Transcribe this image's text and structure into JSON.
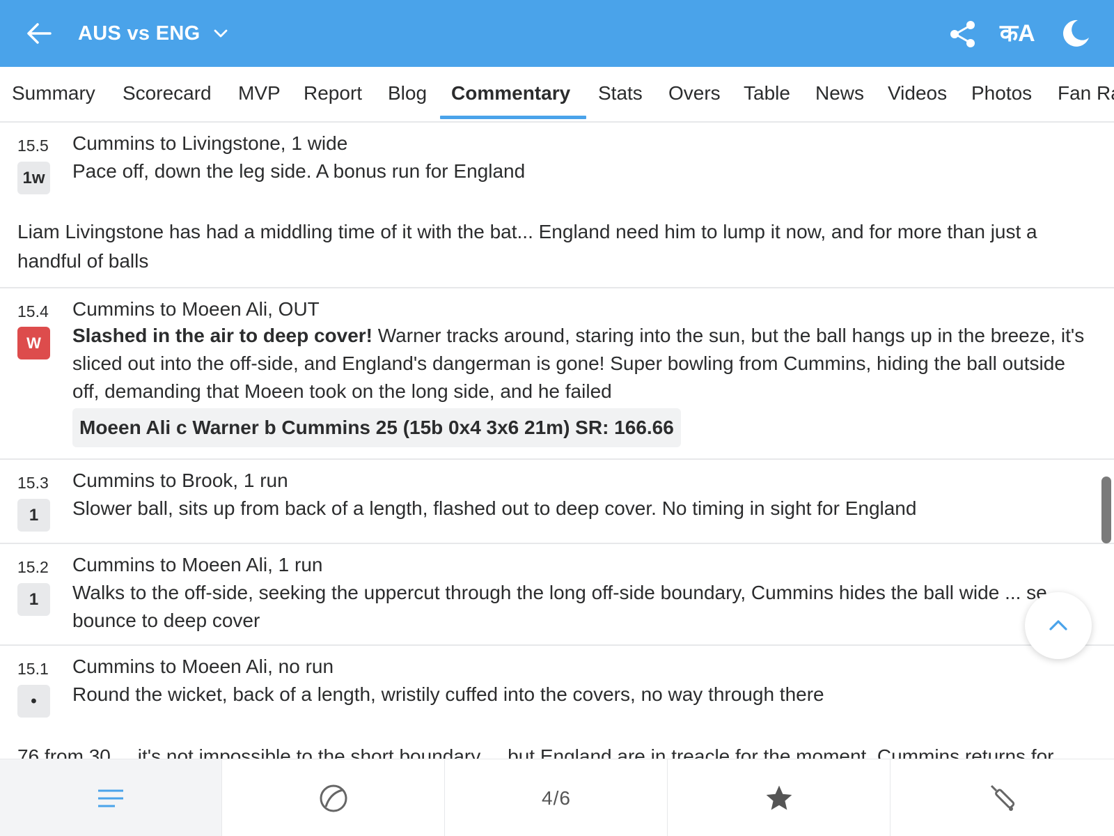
{
  "header": {
    "title": "AUS vs ENG",
    "lang_label": "कA",
    "back_icon": "arrow-left-icon",
    "share_icon": "share-icon",
    "theme_icon": "moon-icon",
    "background": "#4aa3ea"
  },
  "tabs": [
    {
      "label": "Summary"
    },
    {
      "label": "Scorecard"
    },
    {
      "label": "MVP"
    },
    {
      "label": "Report"
    },
    {
      "label": "Blog"
    },
    {
      "label": "Commentary",
      "active": true
    },
    {
      "label": "Stats"
    },
    {
      "label": "Overs"
    },
    {
      "label": "Table"
    },
    {
      "label": "News"
    },
    {
      "label": "Videos"
    },
    {
      "label": "Photos"
    },
    {
      "label": "Fan Ra"
    }
  ],
  "commentary": {
    "e1": {
      "over": "15.5",
      "badge": "1w",
      "headline": "Cummins to Livingstone, 1 wide",
      "text": "Pace off, down the leg side. A bonus run for England",
      "note": "Liam Livingstone has had a middling time of it with the bat... England need him to lump it now, and for more than just a handful of balls"
    },
    "e2": {
      "over": "15.4",
      "badge": "W",
      "headline": "Cummins to Moeen Ali, OUT",
      "text_bold": "Slashed in the air to deep cover!",
      "text": " Warner tracks around, staring into the sun, but the ball hangs up in the breeze, it's sliced out into the off-side, and England's dangerman is gone! Super bowling from Cummins, hiding the ball outside off, demanding that Moeen took on the long side, and he failed",
      "dismissal": "Moeen Ali c Warner b Cummins 25 (15b 0x4 3x6 21m) SR: 166.66"
    },
    "e3": {
      "over": "15.3",
      "badge": "1",
      "headline": "Cummins to Brook, 1 run",
      "text": "Slower ball, sits up from back of a length, flashed out to deep cover. No timing in sight for England"
    },
    "e4": {
      "over": "15.2",
      "badge": "1",
      "headline": "Cummins to Moeen Ali, 1 run",
      "text": "Walks to the off-side, seeking the uppercut through the long off-side boundary, Cummins hides the ball wide ... se bounce to deep cover"
    },
    "e5": {
      "over": "15.1",
      "badge": "•",
      "headline": "Cummins to Moeen Ali, no run",
      "text": "Round the wicket, back of a length, wristily cuffed into the covers, no way through there"
    },
    "cut_text": "76 from 30 ... it's not impossible to the short boundary ... but England are in treacle for the moment. Cummins returns for"
  },
  "bottom_bar": {
    "items": [
      "menu-lines-icon",
      "ball-icon",
      "page-indicator",
      "star-icon",
      "bat-icon"
    ],
    "page": "4/6"
  }
}
